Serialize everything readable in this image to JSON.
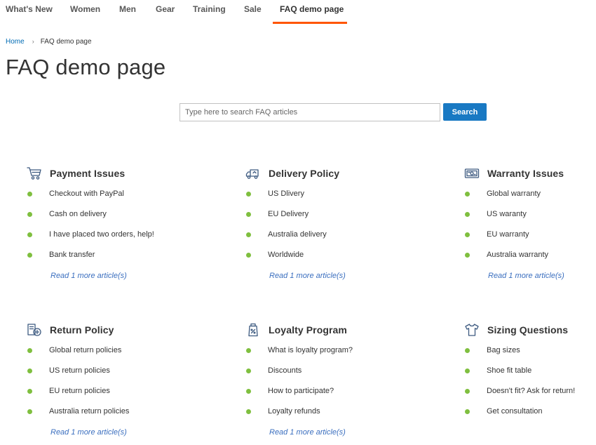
{
  "nav": {
    "items": [
      {
        "label": "What's New",
        "active": false
      },
      {
        "label": "Women",
        "active": false
      },
      {
        "label": "Men",
        "active": false
      },
      {
        "label": "Gear",
        "active": false
      },
      {
        "label": "Training",
        "active": false
      },
      {
        "label": "Sale",
        "active": false
      },
      {
        "label": "FAQ demo page",
        "active": true
      }
    ],
    "active_color": "#ff5501"
  },
  "breadcrumb": {
    "home": "Home",
    "separator": "›",
    "current": "FAQ demo page"
  },
  "page_title": "FAQ demo page",
  "search": {
    "placeholder": "Type here to search FAQ articles",
    "value": "",
    "button_label": "Search",
    "button_color": "#1979c3"
  },
  "colors": {
    "bullet": "#7fbf3f",
    "read_more": "#3b6fbf",
    "icon": "#3d5a80"
  },
  "categories": [
    {
      "title": "Payment Issues",
      "icon": "shopping-cart-icon",
      "items": [
        "Checkout with PayPal",
        "Cash on delivery",
        "I have placed two orders, help!",
        "Bank transfer"
      ],
      "read_more": "Read 1 more article(s)"
    },
    {
      "title": "Delivery Policy",
      "icon": "delivery-truck-icon",
      "items": [
        "US Dlivery",
        "EU Delivery",
        "Australia delivery",
        "Worldwide"
      ],
      "read_more": "Read 1 more article(s)"
    },
    {
      "title": "Warranty Issues",
      "icon": "warranty-certificate-icon",
      "items": [
        "Global warranty",
        "US waranty",
        "EU warranty",
        "Australia warranty"
      ],
      "read_more": "Read 1 more article(s)"
    },
    {
      "title": "Return Policy",
      "icon": "return-box-icon",
      "items": [
        "Global return policies",
        "US return policies",
        "EU return policies",
        "Australia return policies"
      ],
      "read_more": "Read 1 more article(s)"
    },
    {
      "title": "Loyalty Program",
      "icon": "discount-tag-icon",
      "items": [
        "What is loyalty program?",
        "Discounts",
        "How to participate?",
        "Loyalty refunds"
      ],
      "read_more": "Read 1 more article(s)"
    },
    {
      "title": "Sizing Questions",
      "icon": "t-shirt-icon",
      "items": [
        "Bag sizes",
        "Shoe fit table",
        "Doesn't fit? Ask for return!",
        "Get consultation"
      ],
      "read_more": ""
    }
  ]
}
